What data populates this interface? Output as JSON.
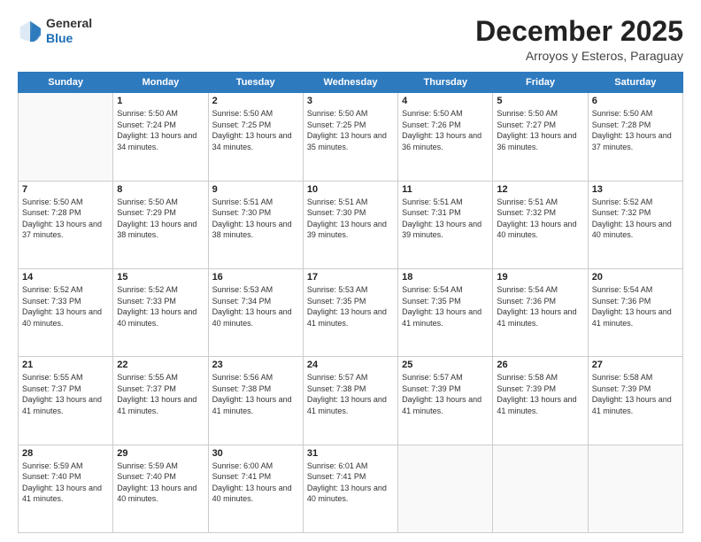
{
  "header": {
    "logo_line1": "General",
    "logo_line2": "Blue",
    "month_title": "December 2025",
    "subtitle": "Arroyos y Esteros, Paraguay"
  },
  "weekdays": [
    "Sunday",
    "Monday",
    "Tuesday",
    "Wednesday",
    "Thursday",
    "Friday",
    "Saturday"
  ],
  "weeks": [
    [
      {
        "day": "",
        "sunrise": "",
        "sunset": "",
        "daylight": ""
      },
      {
        "day": "1",
        "sunrise": "Sunrise: 5:50 AM",
        "sunset": "Sunset: 7:24 PM",
        "daylight": "Daylight: 13 hours and 34 minutes."
      },
      {
        "day": "2",
        "sunrise": "Sunrise: 5:50 AM",
        "sunset": "Sunset: 7:25 PM",
        "daylight": "Daylight: 13 hours and 34 minutes."
      },
      {
        "day": "3",
        "sunrise": "Sunrise: 5:50 AM",
        "sunset": "Sunset: 7:25 PM",
        "daylight": "Daylight: 13 hours and 35 minutes."
      },
      {
        "day": "4",
        "sunrise": "Sunrise: 5:50 AM",
        "sunset": "Sunset: 7:26 PM",
        "daylight": "Daylight: 13 hours and 36 minutes."
      },
      {
        "day": "5",
        "sunrise": "Sunrise: 5:50 AM",
        "sunset": "Sunset: 7:27 PM",
        "daylight": "Daylight: 13 hours and 36 minutes."
      },
      {
        "day": "6",
        "sunrise": "Sunrise: 5:50 AM",
        "sunset": "Sunset: 7:28 PM",
        "daylight": "Daylight: 13 hours and 37 minutes."
      }
    ],
    [
      {
        "day": "7",
        "sunrise": "Sunrise: 5:50 AM",
        "sunset": "Sunset: 7:28 PM",
        "daylight": "Daylight: 13 hours and 37 minutes."
      },
      {
        "day": "8",
        "sunrise": "Sunrise: 5:50 AM",
        "sunset": "Sunset: 7:29 PM",
        "daylight": "Daylight: 13 hours and 38 minutes."
      },
      {
        "day": "9",
        "sunrise": "Sunrise: 5:51 AM",
        "sunset": "Sunset: 7:30 PM",
        "daylight": "Daylight: 13 hours and 38 minutes."
      },
      {
        "day": "10",
        "sunrise": "Sunrise: 5:51 AM",
        "sunset": "Sunset: 7:30 PM",
        "daylight": "Daylight: 13 hours and 39 minutes."
      },
      {
        "day": "11",
        "sunrise": "Sunrise: 5:51 AM",
        "sunset": "Sunset: 7:31 PM",
        "daylight": "Daylight: 13 hours and 39 minutes."
      },
      {
        "day": "12",
        "sunrise": "Sunrise: 5:51 AM",
        "sunset": "Sunset: 7:32 PM",
        "daylight": "Daylight: 13 hours and 40 minutes."
      },
      {
        "day": "13",
        "sunrise": "Sunrise: 5:52 AM",
        "sunset": "Sunset: 7:32 PM",
        "daylight": "Daylight: 13 hours and 40 minutes."
      }
    ],
    [
      {
        "day": "14",
        "sunrise": "Sunrise: 5:52 AM",
        "sunset": "Sunset: 7:33 PM",
        "daylight": "Daylight: 13 hours and 40 minutes."
      },
      {
        "day": "15",
        "sunrise": "Sunrise: 5:52 AM",
        "sunset": "Sunset: 7:33 PM",
        "daylight": "Daylight: 13 hours and 40 minutes."
      },
      {
        "day": "16",
        "sunrise": "Sunrise: 5:53 AM",
        "sunset": "Sunset: 7:34 PM",
        "daylight": "Daylight: 13 hours and 40 minutes."
      },
      {
        "day": "17",
        "sunrise": "Sunrise: 5:53 AM",
        "sunset": "Sunset: 7:35 PM",
        "daylight": "Daylight: 13 hours and 41 minutes."
      },
      {
        "day": "18",
        "sunrise": "Sunrise: 5:54 AM",
        "sunset": "Sunset: 7:35 PM",
        "daylight": "Daylight: 13 hours and 41 minutes."
      },
      {
        "day": "19",
        "sunrise": "Sunrise: 5:54 AM",
        "sunset": "Sunset: 7:36 PM",
        "daylight": "Daylight: 13 hours and 41 minutes."
      },
      {
        "day": "20",
        "sunrise": "Sunrise: 5:54 AM",
        "sunset": "Sunset: 7:36 PM",
        "daylight": "Daylight: 13 hours and 41 minutes."
      }
    ],
    [
      {
        "day": "21",
        "sunrise": "Sunrise: 5:55 AM",
        "sunset": "Sunset: 7:37 PM",
        "daylight": "Daylight: 13 hours and 41 minutes."
      },
      {
        "day": "22",
        "sunrise": "Sunrise: 5:55 AM",
        "sunset": "Sunset: 7:37 PM",
        "daylight": "Daylight: 13 hours and 41 minutes."
      },
      {
        "day": "23",
        "sunrise": "Sunrise: 5:56 AM",
        "sunset": "Sunset: 7:38 PM",
        "daylight": "Daylight: 13 hours and 41 minutes."
      },
      {
        "day": "24",
        "sunrise": "Sunrise: 5:57 AM",
        "sunset": "Sunset: 7:38 PM",
        "daylight": "Daylight: 13 hours and 41 minutes."
      },
      {
        "day": "25",
        "sunrise": "Sunrise: 5:57 AM",
        "sunset": "Sunset: 7:39 PM",
        "daylight": "Daylight: 13 hours and 41 minutes."
      },
      {
        "day": "26",
        "sunrise": "Sunrise: 5:58 AM",
        "sunset": "Sunset: 7:39 PM",
        "daylight": "Daylight: 13 hours and 41 minutes."
      },
      {
        "day": "27",
        "sunrise": "Sunrise: 5:58 AM",
        "sunset": "Sunset: 7:39 PM",
        "daylight": "Daylight: 13 hours and 41 minutes."
      }
    ],
    [
      {
        "day": "28",
        "sunrise": "Sunrise: 5:59 AM",
        "sunset": "Sunset: 7:40 PM",
        "daylight": "Daylight: 13 hours and 41 minutes."
      },
      {
        "day": "29",
        "sunrise": "Sunrise: 5:59 AM",
        "sunset": "Sunset: 7:40 PM",
        "daylight": "Daylight: 13 hours and 40 minutes."
      },
      {
        "day": "30",
        "sunrise": "Sunrise: 6:00 AM",
        "sunset": "Sunset: 7:41 PM",
        "daylight": "Daylight: 13 hours and 40 minutes."
      },
      {
        "day": "31",
        "sunrise": "Sunrise: 6:01 AM",
        "sunset": "Sunset: 7:41 PM",
        "daylight": "Daylight: 13 hours and 40 minutes."
      },
      {
        "day": "",
        "sunrise": "",
        "sunset": "",
        "daylight": ""
      },
      {
        "day": "",
        "sunrise": "",
        "sunset": "",
        "daylight": ""
      },
      {
        "day": "",
        "sunrise": "",
        "sunset": "",
        "daylight": ""
      }
    ]
  ]
}
